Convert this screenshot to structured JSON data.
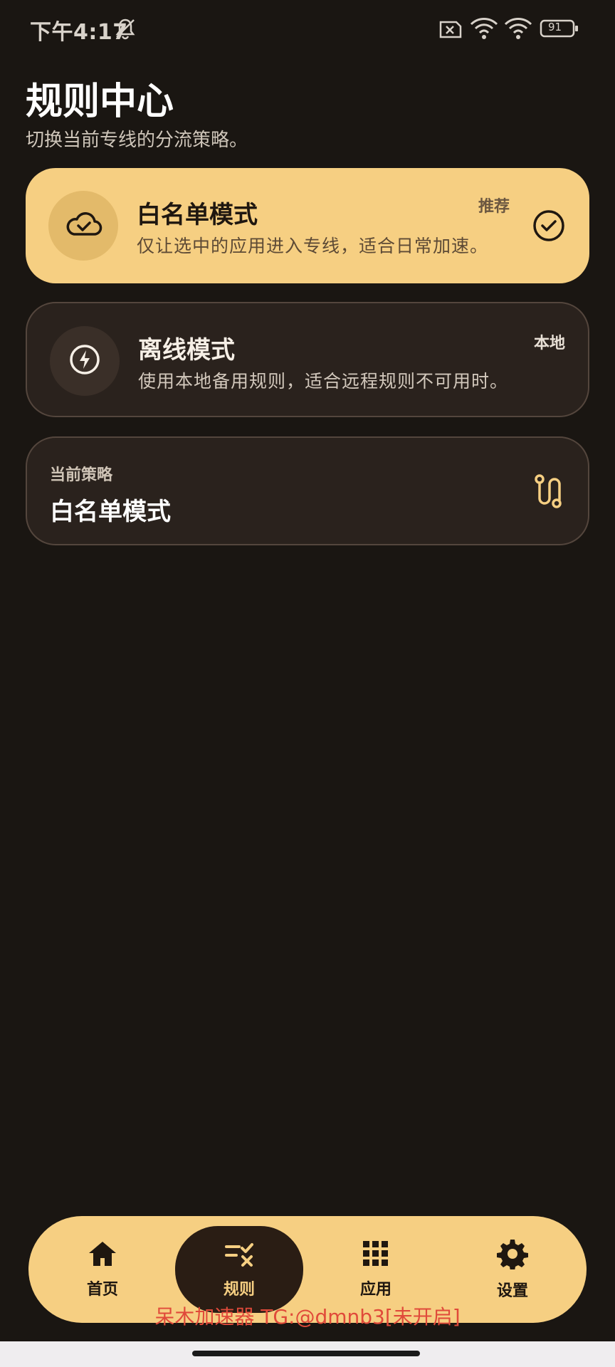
{
  "status_bar": {
    "time": "下午4:17",
    "battery": "91"
  },
  "header": {
    "title": "规则中心",
    "subtitle": "切换当前专线的分流策略。"
  },
  "modes": [
    {
      "title": "白名单模式",
      "description": "仅让选中的应用进入专线，适合日常加速。",
      "badge": "推荐",
      "icon": "cloud-check-icon",
      "selected": true
    },
    {
      "title": "离线模式",
      "description": "使用本地备用规则，适合远程规则不可用时。",
      "badge": "本地",
      "icon": "lightning-icon",
      "selected": false
    }
  ],
  "current_strategy": {
    "label": "当前策略",
    "value": "白名单模式"
  },
  "bottom_nav": [
    {
      "label": "首页",
      "icon": "home-icon",
      "active": false
    },
    {
      "label": "规则",
      "icon": "rules-icon",
      "active": true
    },
    {
      "label": "应用",
      "icon": "apps-grid-icon",
      "active": false
    },
    {
      "label": "设置",
      "icon": "gear-icon",
      "active": false
    }
  ],
  "watermark": "呆木加速器 TG:@dmnb3[未开启]",
  "colors": {
    "background": "#1a1612",
    "accent": "#f6cf82",
    "card_dark": "#2a221d",
    "watermark": "#e04a3a"
  }
}
